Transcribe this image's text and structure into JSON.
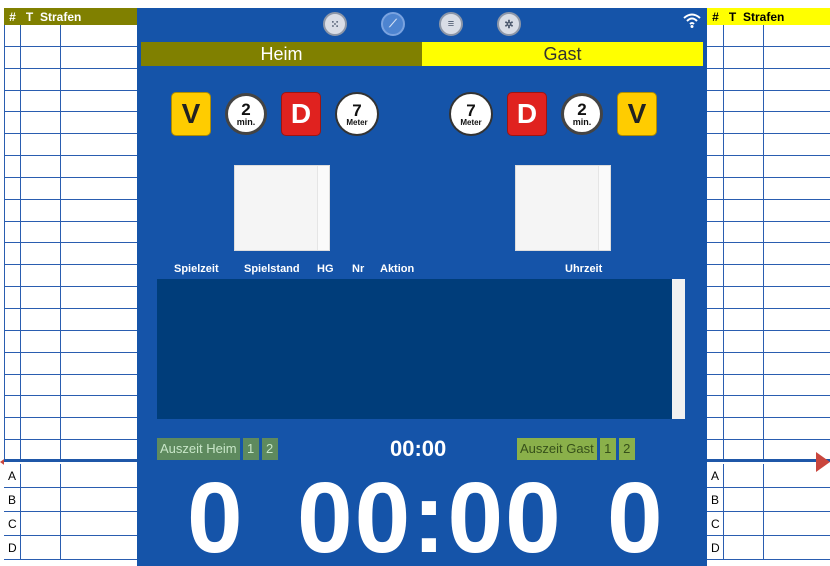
{
  "left_table": {
    "headers": [
      "#",
      "T",
      "Strafen"
    ],
    "bottom_rows": [
      "A",
      "B",
      "C",
      "D"
    ]
  },
  "right_table": {
    "headers": [
      "#",
      "T",
      "Strafen"
    ],
    "bottom_rows": [
      "A",
      "B",
      "C",
      "D"
    ]
  },
  "toolbar": {
    "icons": [
      "keypad-icon",
      "compass-icon",
      "list-icon",
      "settings-icon",
      "wifi-icon"
    ]
  },
  "teams": {
    "home": "Heim",
    "guest": "Gast"
  },
  "home_buttons": {
    "warning": "V",
    "suspension_value": "2",
    "suspension_unit": "min.",
    "disqualification": "D",
    "seven_meter_value": "7",
    "seven_meter_unit": "Meter"
  },
  "guest_buttons": {
    "warning": "V",
    "suspension_value": "2",
    "suspension_unit": "min.",
    "disqualification": "D",
    "seven_meter_value": "7",
    "seven_meter_unit": "Meter"
  },
  "log_columns": [
    "Spielzeit",
    "Spielstand",
    "HG",
    "Nr",
    "Aktion",
    "Uhrzeit"
  ],
  "timeouts": {
    "home_label": "Auszeit Heim",
    "guest_label": "Auszeit Gast",
    "numbers": [
      "1",
      "2"
    ]
  },
  "timeout_clock": "00:00",
  "score_home": "0",
  "score_guest": "0",
  "game_clock": "00:00",
  "colors": {
    "board": "#1554a9",
    "home": "#808000",
    "guest": "#ffff00"
  }
}
